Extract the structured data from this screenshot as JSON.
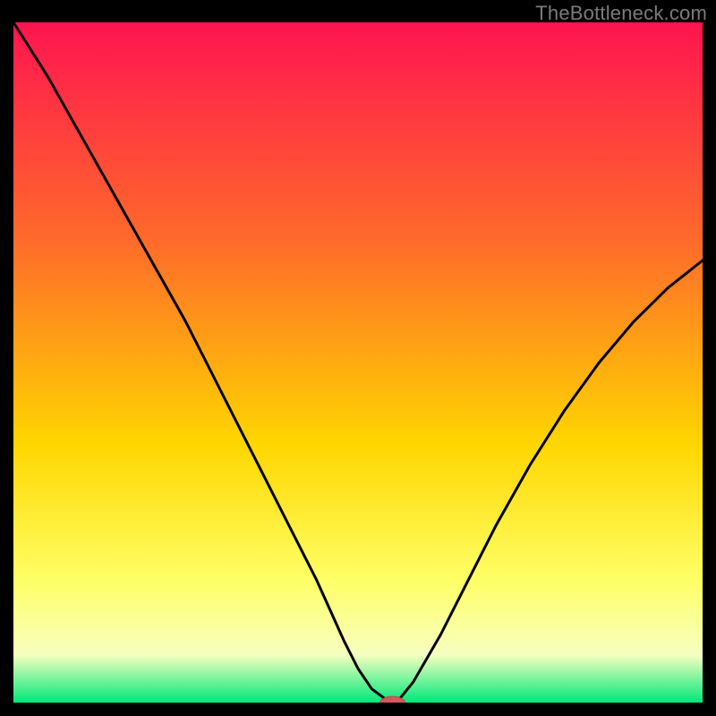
{
  "watermark": "TheBottleneck.com",
  "colors": {
    "bg": "#000000",
    "curve": "#000000",
    "marker_fill": "#d15a5a",
    "marker_stroke": "#b94a4a",
    "grad_top": "#ff1450",
    "grad_upper_mid": "#ff6a2a",
    "grad_mid": "#ffd600",
    "grad_lower_mid": "#ffff66",
    "grad_pale": "#f6ffc0",
    "grad_green": "#00e87a"
  },
  "chart_data": {
    "type": "line",
    "title": "",
    "xlabel": "",
    "ylabel": "",
    "xlim": [
      0,
      100
    ],
    "ylim": [
      0,
      100
    ],
    "x": [
      0,
      5,
      10,
      15,
      20,
      25,
      28,
      32,
      36,
      40,
      44,
      48,
      50,
      52,
      54,
      55,
      56,
      58,
      62,
      66,
      70,
      75,
      80,
      85,
      90,
      95,
      100
    ],
    "values": [
      100,
      92,
      83,
      74,
      65,
      56,
      50,
      42,
      34,
      26,
      18,
      9,
      5,
      2,
      0.5,
      0,
      0.5,
      3,
      10,
      18,
      26,
      35,
      43,
      50,
      56,
      61,
      65
    ],
    "series": [
      {
        "name": "bottleneck-curve",
        "x_ref": "x",
        "y_ref": "values"
      }
    ],
    "marker": {
      "x": 55,
      "y": 0,
      "rx": 1.8,
      "ry": 0.9
    },
    "background_gradient_stops": [
      {
        "offset": 0.0,
        "color_ref": "grad_top"
      },
      {
        "offset": 0.32,
        "color_ref": "grad_upper_mid"
      },
      {
        "offset": 0.62,
        "color_ref": "grad_mid"
      },
      {
        "offset": 0.82,
        "color_ref": "grad_lower_mid"
      },
      {
        "offset": 0.93,
        "color_ref": "grad_pale"
      },
      {
        "offset": 1.0,
        "color_ref": "grad_green"
      }
    ]
  }
}
